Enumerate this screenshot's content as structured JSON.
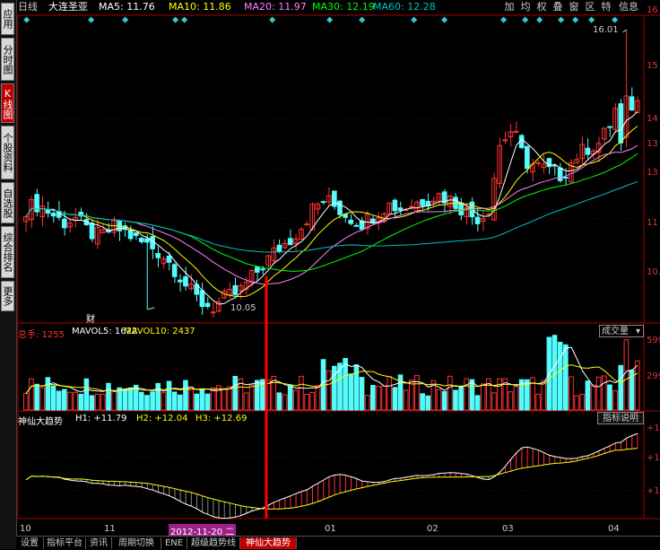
{
  "left_tabs": [
    {
      "label": "应用",
      "active": false
    },
    {
      "label": "分时图",
      "active": false
    },
    {
      "label": "K线图",
      "active": true
    },
    {
      "label": "个股资料",
      "active": false
    },
    {
      "label": "自选股",
      "active": false
    },
    {
      "label": "综合排名",
      "active": false
    },
    {
      "label": "更多",
      "active": false
    }
  ],
  "header": {
    "period": "日线",
    "stock_name": "大连圣亚",
    "ma5": "MA5: 11.76",
    "ma10": "MA10: 11.86",
    "ma20": "MA20: 11.97",
    "ma30": "MA30: 12.19",
    "ma60": "MA60: 12.28"
  },
  "right_buttons": [
    "加",
    "均",
    "权",
    "叠",
    "窗",
    "区",
    "特",
    "信息"
  ],
  "y_axis_price": [
    "16",
    "15",
    "14",
    "13",
    "12",
    "11",
    "10."
  ],
  "price_annotations": {
    "high": "16.01",
    "low": "10.05",
    "event": "财"
  },
  "volume_panel": {
    "label_total": "总手: 1255",
    "label_mavol5": "MAVOL5: 1622",
    "label_mavol10": "MAVOL10: 2437",
    "select_value": "成交量",
    "y_labels": [
      "599",
      "299"
    ]
  },
  "indicator_panel": {
    "name": "神仙大趋势",
    "h1": "H1: +11.79",
    "h2": "H2: +12.04",
    "h3": "H3: +12.69",
    "button": "指标说明",
    "y_labels": [
      "+14",
      "+13",
      "+11"
    ]
  },
  "x_axis": {
    "labels": [
      "10",
      "11",
      "2012-11-20 二",
      "01",
      "02",
      "03",
      "04"
    ]
  },
  "bottom_tabs": [
    {
      "label": "设置",
      "active": false
    },
    {
      "label": "指标平台",
      "active": false
    },
    {
      "label": "资讯",
      "active": false
    },
    {
      "label": "周期切换",
      "active": false
    },
    {
      "label": "ENE",
      "active": false
    },
    {
      "label": "超级趋势线",
      "active": false
    },
    {
      "label": "神仙大趋势",
      "active": true
    }
  ],
  "colors": {
    "up": "#ff3232",
    "down": "#54fcfc",
    "ma5": "#ffffff",
    "ma10": "#ffff00",
    "ma20": "#ff80ff",
    "ma30": "#00ff00",
    "ma60": "#00c0c0",
    "cursor": "#ff0000"
  },
  "chart_data": {
    "type": "line",
    "title": "大连圣亚 日线",
    "x": [
      "10",
      "11",
      "2012-11-20",
      "01",
      "02",
      "03",
      "04"
    ],
    "candles_close_approx": [
      12.2,
      12.3,
      12.1,
      11.9,
      12.0,
      11.7,
      11.6,
      11.8,
      11.7,
      11.5,
      11.4,
      11.2,
      10.9,
      10.5,
      10.2,
      10.1,
      10.3,
      10.4,
      10.7,
      11.0,
      11.3,
      11.5,
      11.8,
      12.2,
      12.4,
      12.2,
      12.0,
      11.9,
      12.1,
      12.3,
      12.2,
      12.3,
      12.4,
      12.5,
      12.4,
      12.2,
      12.0,
      12.1,
      13.6,
      13.9,
      13.2,
      13.1,
      13.0,
      12.9,
      13.3,
      13.5,
      13.6,
      14.1,
      15.0,
      14.3
    ],
    "series": [
      {
        "name": "MA5",
        "last": 11.76
      },
      {
        "name": "MA10",
        "last": 11.86
      },
      {
        "name": "MA20",
        "last": 11.97
      },
      {
        "name": "MA30",
        "last": 12.19
      },
      {
        "name": "MA60",
        "last": 12.28
      }
    ],
    "ylim": [
      9.8,
      16.3
    ],
    "high": 16.01,
    "low": 10.05
  }
}
